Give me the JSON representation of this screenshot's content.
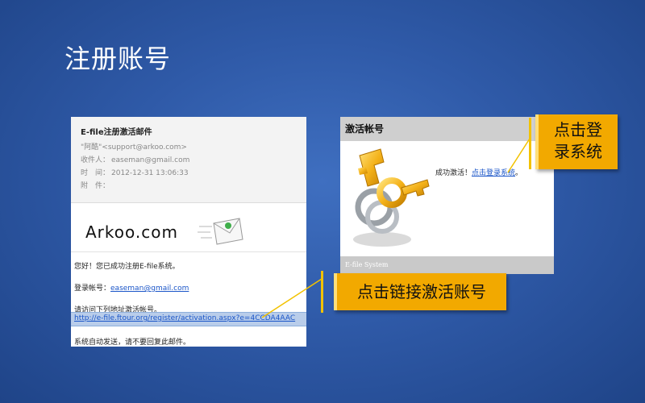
{
  "slide": {
    "title": "注册账号"
  },
  "email": {
    "subject": "E-file注册激活邮件",
    "from": "\"阿酷\"<support@arkoo.com>",
    "to_label": "收件人：",
    "to_value": "easeman@gmail.com",
    "time_label": "时　间：",
    "time_value": "2012-12-31 13:06:33",
    "attach_label": "附　件：",
    "brand": "Arkoo.com",
    "greeting": "您好！您已成功注册E-file系统。",
    "account_label": "登录帐号：",
    "account_email": "easeman@gmail.com",
    "instruction": "请访问下列地址激活帐号。",
    "activation_link": "http://e-file.ftour.org/register/activation.aspx?e=4CCDA4AAC",
    "footer": "系统自动发送，请不要回复此邮件。"
  },
  "activation": {
    "title": "激活帐号",
    "success_text": "成功激活！",
    "login_link": "点击登录系统",
    "period": "。",
    "footer": "E-file System"
  },
  "callouts": {
    "login_line1": "点击登",
    "login_line2": "录系统",
    "link": "点击链接激活账号"
  },
  "colors": {
    "background": "#2f5aa8",
    "callout": "#f2a900",
    "link": "#1a55c8"
  }
}
